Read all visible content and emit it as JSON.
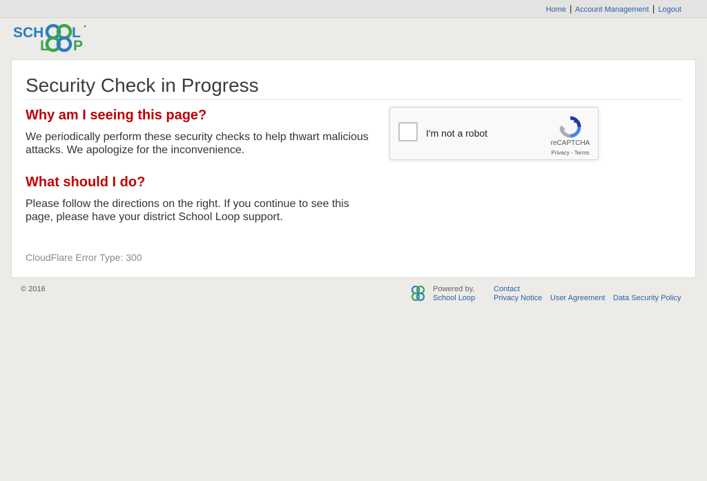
{
  "topnav": {
    "home": "Home",
    "separator": "|",
    "account": "Account Management",
    "logout": "Logout"
  },
  "logo": {
    "line1": "SCH",
    "line1_end": "L",
    "line2_start": "L",
    "line2_end": "P",
    "colors": {
      "blue": "#2b7dc0",
      "green": "#3aa64b",
      "dark": "#1f6b5a"
    }
  },
  "main": {
    "title": "Security Check in Progress",
    "why_heading": "Why am I seeing this page?",
    "why_text": "We periodically perform these security checks to help thwart malicious attacks. We apologize for the inconvenience.",
    "what_heading": "What should I do?",
    "what_text": "Please follow the directions on the right. If you continue to see this page, please have your district School Loop support.",
    "error_type": "CloudFlare Error Type: 300"
  },
  "recaptcha": {
    "label": "I'm not a robot",
    "brand": "reCAPTCHA",
    "links": "Privacy - Terms",
    "checked": false
  },
  "footer": {
    "copyright": "© 2016",
    "powered_by": "Powered by,",
    "school_loop": "School Loop",
    "contact": "Contact",
    "privacy": "Privacy Notice",
    "agreement": "User Agreement",
    "security": "Data Security Policy"
  },
  "colors": {
    "heading_red": "#c00000",
    "link_blue": "#2a5fa8",
    "background": "#ecebe7"
  }
}
